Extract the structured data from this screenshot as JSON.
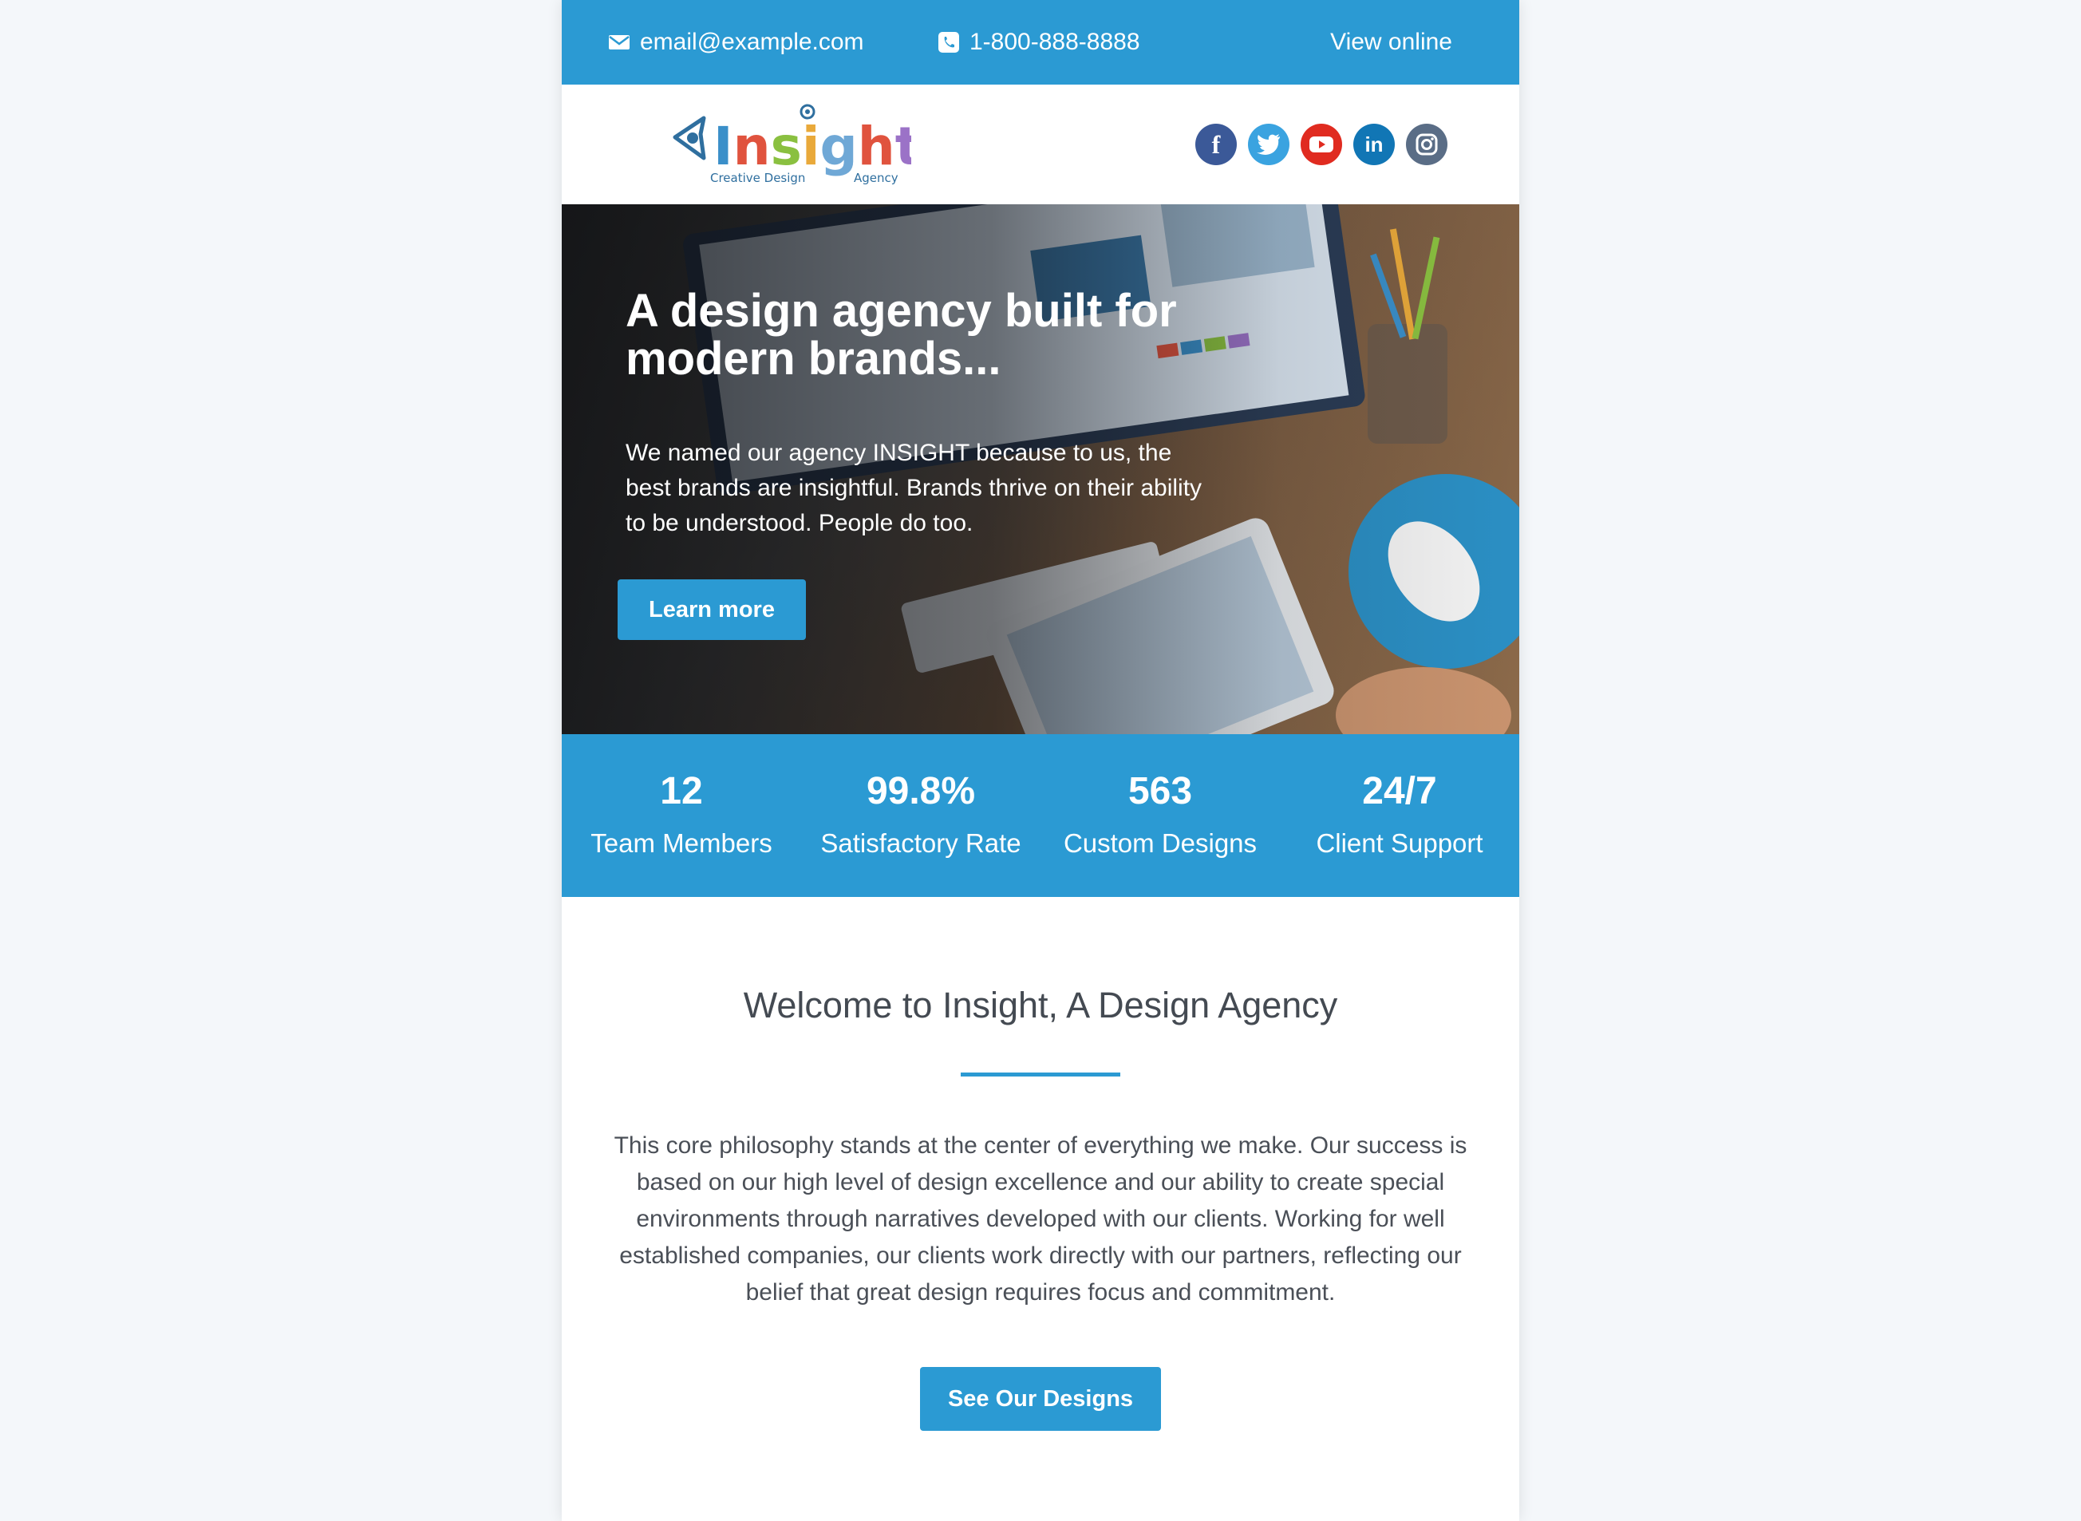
{
  "topbar": {
    "email": "email@example.com",
    "phone": "1-800-888-8888",
    "view_online": "View online",
    "email_icon": "envelope-icon",
    "phone_icon": "phone-icon"
  },
  "logo": {
    "name": "Insight",
    "tagline_left": "Creative Design",
    "tagline_right": "Agency"
  },
  "social": [
    "facebook-icon",
    "twitter-icon",
    "youtube-icon",
    "linkedin-icon",
    "instagram-icon"
  ],
  "hero": {
    "title": "A design agency built for modern brands...",
    "body": "We named our agency INSIGHT because to us, the best brands are insightful. Brands thrive on their ability to be understood. People do too.",
    "button": "Learn more"
  },
  "stats": [
    {
      "value": "12",
      "label": "Team Members"
    },
    {
      "value": "99.8%",
      "label": "Satisfactory Rate"
    },
    {
      "value": "563",
      "label": "Custom Designs"
    },
    {
      "value": "24/7",
      "label": "Client Support"
    }
  ],
  "welcome": {
    "title": "Welcome to Insight, A Design Agency",
    "body": "This core philosophy stands at the center of everything we make. Our success is based on our high level of design excellence and our ability to create special environments through narratives developed with our clients. Working for well established companies, our clients work directly with our partners, reflecting our belief that great design requires focus and commitment.",
    "button": "See Our Designs"
  },
  "colors": {
    "accent": "#2b9ad3",
    "page_bg": "#f4f7fa",
    "text": "#4a4f57"
  }
}
